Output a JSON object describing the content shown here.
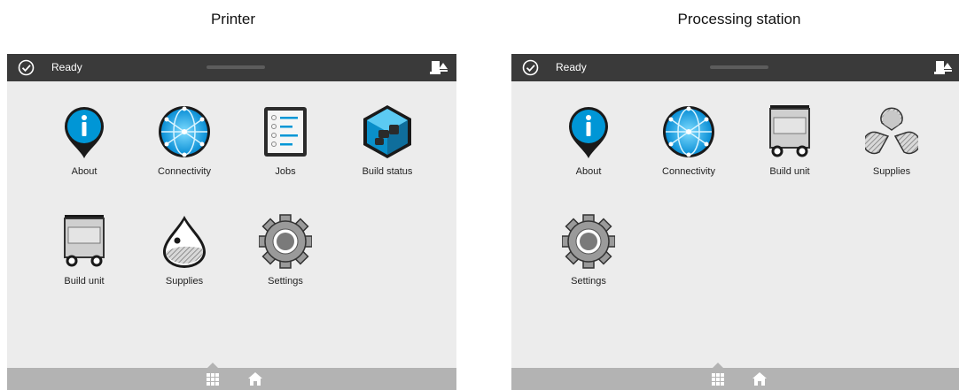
{
  "panels": [
    {
      "title": "Printer",
      "status": "Ready",
      "apps": [
        {
          "label": "About",
          "icon": "info-icon"
        },
        {
          "label": "Connectivity",
          "icon": "network-globe-icon"
        },
        {
          "label": "Jobs",
          "icon": "jobs-list-icon"
        },
        {
          "label": "Build status",
          "icon": "build-status-cube-icon"
        },
        {
          "label": "Build unit",
          "icon": "build-unit-cart-icon"
        },
        {
          "label": "Supplies",
          "icon": "supplies-drop-icon"
        },
        {
          "label": "Settings",
          "icon": "gear-icon"
        }
      ]
    },
    {
      "title": "Processing station",
      "status": "Ready",
      "apps": [
        {
          "label": "About",
          "icon": "info-icon"
        },
        {
          "label": "Connectivity",
          "icon": "network-globe-icon"
        },
        {
          "label": "Build unit",
          "icon": "build-unit-cart-icon"
        },
        {
          "label": "Supplies",
          "icon": "supplies-segments-icon"
        },
        {
          "label": "Settings",
          "icon": "gear-icon"
        }
      ]
    }
  ],
  "colors": {
    "topbar": "#3a3a3a",
    "screen_bg": "#ececec",
    "bottombar": "#b3b3b3",
    "accent_blue": "#0096d6"
  },
  "icons": {
    "status": "checkmark-circle-icon",
    "alerts": "alert-tray-icon",
    "apps_nav": "apps-grid-icon",
    "home_nav": "home-icon"
  }
}
